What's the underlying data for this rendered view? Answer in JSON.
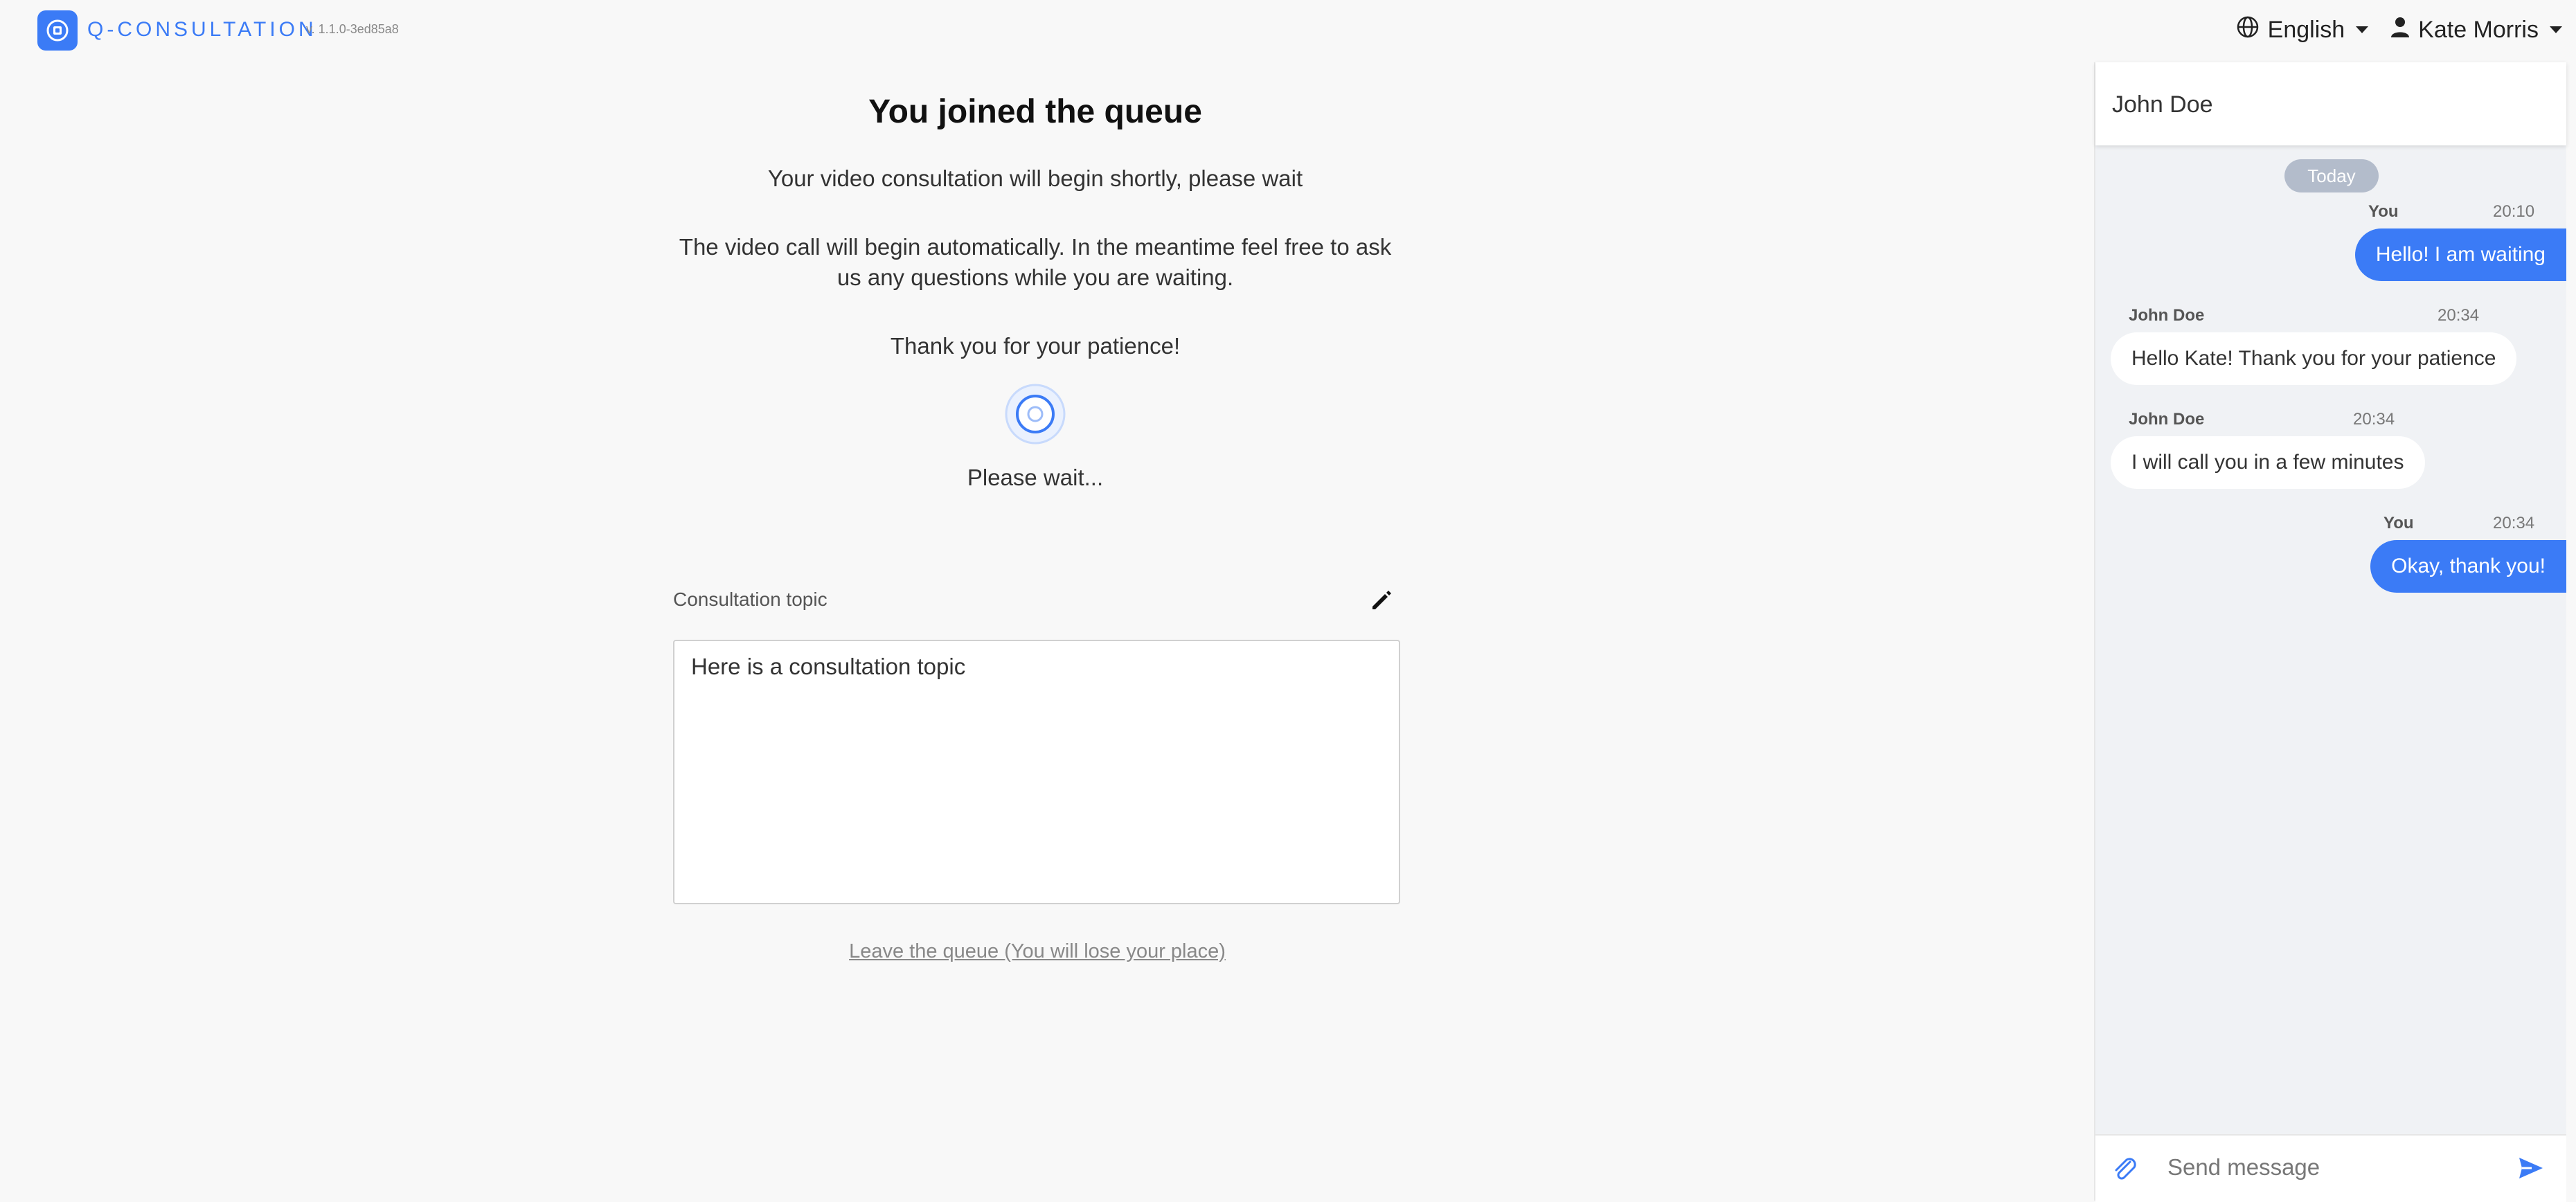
{
  "header": {
    "brand": "Q-CONSULTATION",
    "version": "v. 1.1.0-3ed85a8",
    "language": "English",
    "user": "Kate Morris"
  },
  "main": {
    "title": "You joined the queue",
    "subtitle": "Your video consultation will begin shortly, please wait",
    "description_line1": "The video call will begin automatically. In the meantime feel free to ask",
    "description_line2": "us any questions while you are waiting.",
    "thanks": "Thank you for your patience!",
    "please_wait": "Please wait...",
    "topic_label": "Consultation topic",
    "topic_value": "Here is a consultation topic",
    "leave_link": "Leave the queue (You will lose your place)"
  },
  "chat": {
    "contact": "John Doe",
    "date_badge": "Today",
    "messages": [
      {
        "sender": "You",
        "time": "20:10",
        "text": "Hello! I am waiting"
      },
      {
        "sender": "John Doe",
        "time": "20:34",
        "text": "Hello Kate! Thank you for your patience"
      },
      {
        "sender": "John Doe",
        "time": "20:34",
        "text": "I will call you in a few minutes"
      },
      {
        "sender": "You",
        "time": "20:34",
        "text": "Okay, thank you!"
      }
    ],
    "input_placeholder": "Send message"
  },
  "colors": {
    "accent": "#3b7bf6",
    "background": "#f8f8f8",
    "chat_background": "#f0f2f5",
    "date_badge": "#b3bccb"
  },
  "icons": {
    "logo": "logo-icon",
    "language": "globe-icon",
    "user": "user-icon",
    "edit": "pencil-icon",
    "spinner": "spinner-icon",
    "attach": "paperclip-icon",
    "send": "send-icon"
  }
}
